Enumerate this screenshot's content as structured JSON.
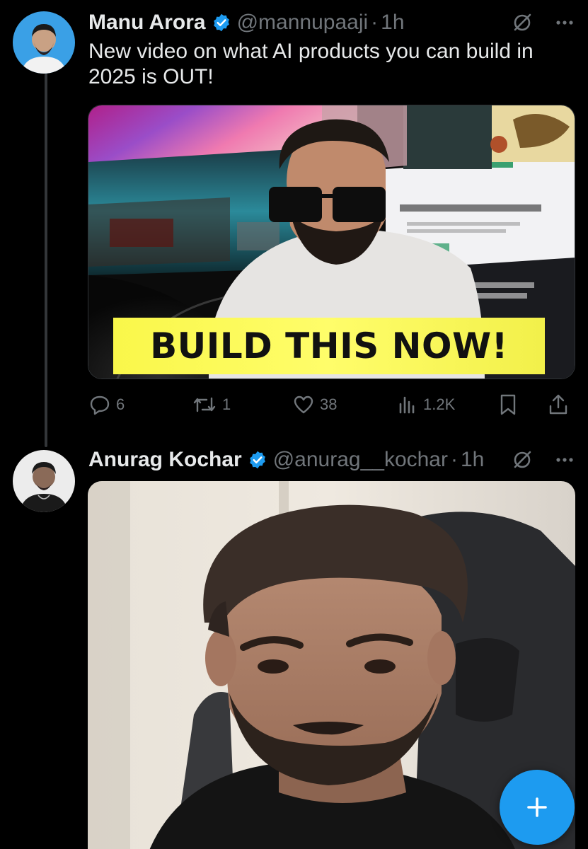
{
  "colors": {
    "background": "#000000",
    "text_primary": "#e7e9ea",
    "text_secondary": "#71767b",
    "verified_blue": "#1d9bf0",
    "fab_blue": "#1d9bf0"
  },
  "tweets": [
    {
      "author_name": "Manu Arora",
      "handle": "@mannupaaji",
      "separator": "·",
      "time": "1h",
      "verified": true,
      "text": "New video on what AI products you can build in 2025 is OUT!",
      "media": {
        "kind": "video-thumbnail",
        "overlay_text": "BUILD THIS NOW!"
      },
      "stats": {
        "replies": "6",
        "reposts": "1",
        "likes": "38",
        "views": "1.2K"
      },
      "icons": [
        "grok-icon",
        "more-icon",
        "reply-icon",
        "repost-icon",
        "like-icon",
        "views-icon",
        "bookmark-icon",
        "share-icon"
      ]
    },
    {
      "author_name": "Anurag Kochar",
      "handle": "@anurag__kochar",
      "separator": "·",
      "time": "1h",
      "verified": true,
      "media": {
        "kind": "photo"
      },
      "icons": [
        "grok-icon",
        "more-icon"
      ]
    }
  ],
  "fab": {
    "icon": "plus-icon"
  }
}
